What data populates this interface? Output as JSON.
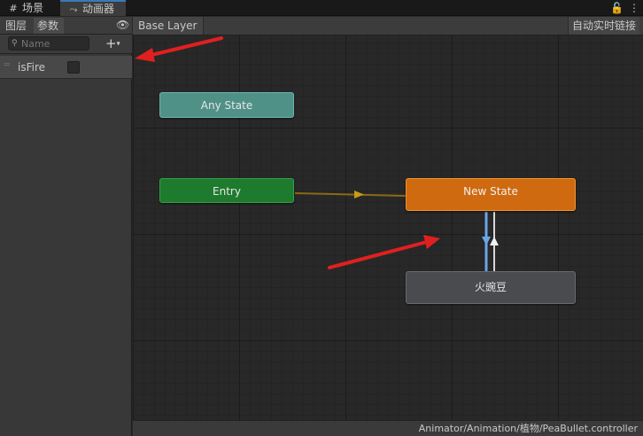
{
  "tabs": {
    "scene": {
      "label": "场景",
      "icon": "grid-icon"
    },
    "animator": {
      "label": "动画器",
      "icon": "animator-icon"
    }
  },
  "tabbar_right": {
    "lock_icon": "lock-icon",
    "menu_icon": "kebab-menu-icon"
  },
  "left_panel": {
    "tabs": {
      "layers": "图层",
      "parameters": "参数"
    },
    "eye_icon": "eye-icon",
    "search": {
      "placeholder": "Name",
      "value": ""
    },
    "add_button": {
      "symbol": "+",
      "chevron": "▾"
    },
    "parameters": [
      {
        "name": "isFire",
        "type": "bool",
        "value": false
      }
    ]
  },
  "graph": {
    "breadcrumb": "Base Layer",
    "auto_link_label": "自动实时链接",
    "states": {
      "any": "Any State",
      "entry": "Entry",
      "new_state": "New State",
      "pea": "火豌豆"
    }
  },
  "status_bar": {
    "path": "Animator/Animation/植物/PeaBullet.controller"
  },
  "colors": {
    "accent": "#3a79bb",
    "any_state": "#4f9187",
    "entry": "#1e7a2c",
    "default_state": "#cf6a10",
    "state": "#4a4b4f",
    "annotation_arrow": "#e02020"
  }
}
